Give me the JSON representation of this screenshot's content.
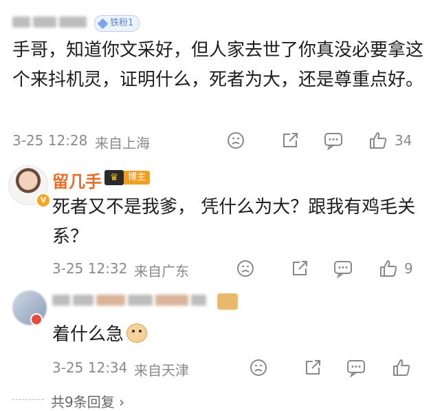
{
  "comment": {
    "fan_badge": "铁粉1",
    "text": "手哥，知道你文采好，但人家去世了你真没必要拿这个来抖机灵，证明什么，死者为大，还是尊重点好。",
    "time": "3-25 12:28",
    "location": "来自上海",
    "likes": "34"
  },
  "reply1": {
    "name": "留几手",
    "badge": "博主",
    "text": "死者又不是我爹， 凭什么为大？跟我有鸡毛关系？",
    "time": "3-25 12:32",
    "location": "来自广东",
    "likes": "9"
  },
  "reply2": {
    "text": "着什么急",
    "time": "3-25 12:34",
    "location": "来自天津"
  },
  "more_replies": "共9条回复 ›",
  "colors": {
    "accent_name": "#e86b26",
    "meta": "#8a8a8a",
    "badge_blue": "#5a86d6"
  }
}
